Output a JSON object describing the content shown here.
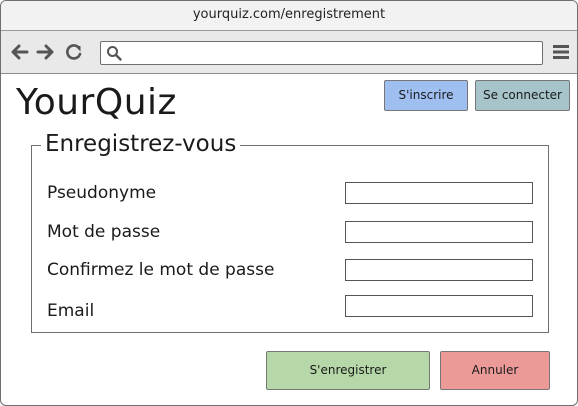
{
  "browser": {
    "url_title": "yourquiz.com/enregistrement",
    "address_value": "",
    "icons": {
      "back": "arrow-left-icon",
      "forward": "arrow-right-icon",
      "reload": "reload-icon",
      "search": "search-icon",
      "menu": "hamburger-menu-icon"
    }
  },
  "header": {
    "logo": "YourQuiz",
    "signup_label": "S'inscrire",
    "login_label": "Se connecter",
    "signup_color": "#9fbff0",
    "login_color": "#a6c4c9"
  },
  "form": {
    "legend": "Enregistrez-vous",
    "fields": [
      {
        "label": "Pseudonyme",
        "value": ""
      },
      {
        "label": "Mot de passe",
        "value": ""
      },
      {
        "label": "Confirmez le mot de passe",
        "value": ""
      },
      {
        "label": "Email",
        "value": ""
      }
    ],
    "submit_label": "S'enregistrer",
    "cancel_label": "Annuler",
    "submit_color": "#b6d8a8",
    "cancel_color": "#ec9a98"
  }
}
